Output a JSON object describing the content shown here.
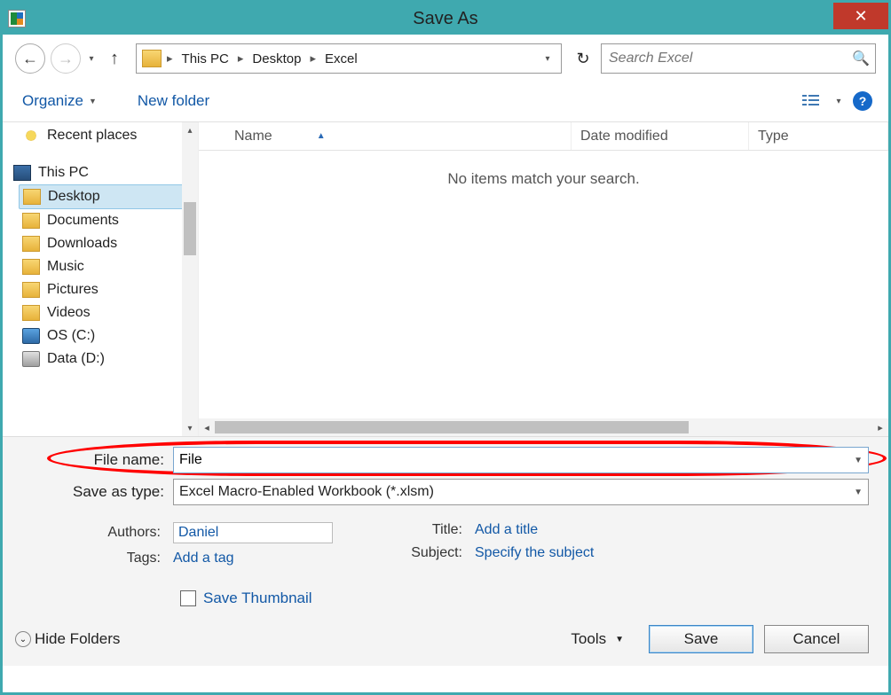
{
  "titlebar": {
    "title": "Save As"
  },
  "nav": {
    "breadcrumb": [
      "This PC",
      "Desktop",
      "Excel"
    ],
    "search_placeholder": "Search Excel"
  },
  "toolbar": {
    "organize": "Organize",
    "new_folder": "New folder"
  },
  "sidebar": {
    "items": [
      {
        "label": "Recent places",
        "icon": "fav",
        "level": 1
      },
      {
        "label": "This PC",
        "icon": "pc",
        "level": 0
      },
      {
        "label": "Desktop",
        "icon": "fold",
        "level": 1,
        "selected": true
      },
      {
        "label": "Documents",
        "icon": "fold",
        "level": 1
      },
      {
        "label": "Downloads",
        "icon": "fold",
        "level": 1
      },
      {
        "label": "Music",
        "icon": "fold",
        "level": 1
      },
      {
        "label": "Pictures",
        "icon": "fold",
        "level": 1
      },
      {
        "label": "Videos",
        "icon": "fold",
        "level": 1
      },
      {
        "label": "OS (C:)",
        "icon": "drvwin",
        "level": 1
      },
      {
        "label": "Data (D:)",
        "icon": "drv",
        "level": 1
      }
    ]
  },
  "fileview": {
    "columns": {
      "name": "Name",
      "date_modified": "Date modified",
      "type": "Type"
    },
    "empty_message": "No items match your search."
  },
  "form": {
    "file_name_label": "File name:",
    "file_name_value": "File",
    "save_as_type_label": "Save as type:",
    "save_as_type_value": "Excel Macro-Enabled Workbook (*.xlsm)",
    "authors_label": "Authors:",
    "authors_value": "Daniel",
    "tags_label": "Tags:",
    "tags_value": "Add a tag",
    "title_label": "Title:",
    "title_value": "Add a title",
    "subject_label": "Subject:",
    "subject_value": "Specify the subject",
    "save_thumbnail_label": "Save Thumbnail"
  },
  "footer": {
    "hide_folders": "Hide Folders",
    "tools": "Tools",
    "save": "Save",
    "cancel": "Cancel"
  }
}
